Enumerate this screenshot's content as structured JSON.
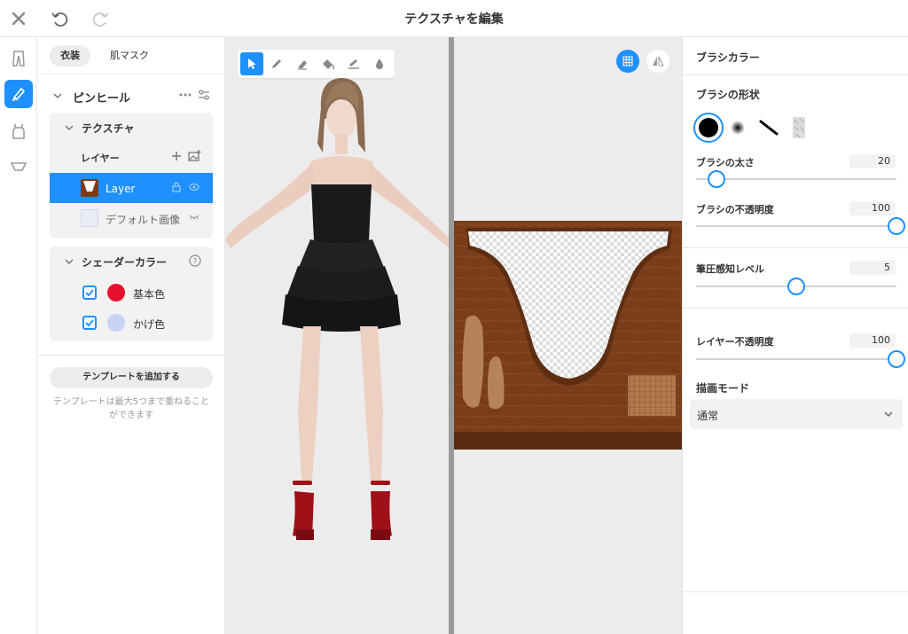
{
  "header": {
    "title": "テクスチャを編集"
  },
  "rail": {
    "icons": [
      "pants-icon",
      "brush-icon",
      "tank-top-icon",
      "shoe-icon"
    ]
  },
  "panel": {
    "tabs": [
      "衣装",
      "肌マスク"
    ],
    "item": {
      "name": "ピンヒール"
    },
    "texture": {
      "title": "テクスチャ",
      "layer_header": "レイヤー",
      "layers": [
        {
          "name": "Layer"
        },
        {
          "name": "デフォルト画像"
        }
      ]
    },
    "shader": {
      "title": "シェーダーカラー",
      "colors": [
        {
          "name": "基本色",
          "color": "#e8102e"
        },
        {
          "name": "かげ色",
          "color": "#c8d2f5"
        }
      ]
    },
    "add_template": "テンプレートを追加する",
    "template_note": "テンプレートは最大5つまで重ねることができます"
  },
  "brush": {
    "title": "ブラシカラー",
    "shape_title": "ブラシの形状",
    "size_label": "ブラシの太さ",
    "size_value": "20",
    "size_fraction": 0.1,
    "opacity_label": "ブラシの不透明度",
    "opacity_value": "100",
    "opacity_fraction": 1.0,
    "pressure_label": "筆圧感知レベル",
    "pressure_value": "5",
    "pressure_fraction": 0.5,
    "layer_opacity_label": "レイヤー不透明度",
    "layer_opacity_value": "100",
    "layer_opacity_fraction": 1.0,
    "mode_title": "描画モード",
    "mode_value": "通常"
  },
  "colors": {
    "accent": "#1e90ff",
    "dress": "#1a1a1a",
    "heels": "#a01018",
    "uv_brown": "#7a3d1a"
  }
}
